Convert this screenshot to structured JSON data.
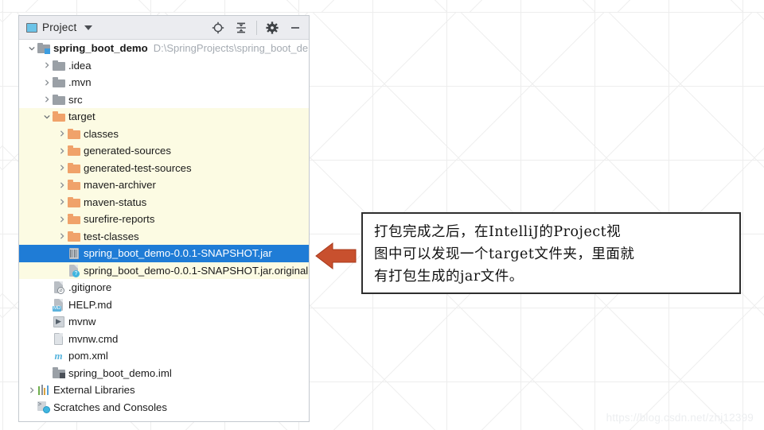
{
  "panel": {
    "header": {
      "icon": "project-view-icon",
      "title": "Project",
      "dropdown_icon": "chevron-down-icon",
      "tools": [
        {
          "name": "locate-in-tree-icon",
          "label": "Select Opened File"
        },
        {
          "name": "collapse-all-icon",
          "label": "Collapse All"
        },
        {
          "name": "gear-icon",
          "label": "Settings"
        },
        {
          "name": "minimize-icon",
          "label": "Hide"
        }
      ]
    },
    "tree": [
      {
        "indent": 0,
        "twisty": "expanded",
        "icon": "module-icon",
        "label": "spring_boot_demo",
        "bold": true,
        "path": "D:\\SpringProjects\\spring_boot_dem",
        "state": "normal"
      },
      {
        "indent": 1,
        "twisty": "collapsed",
        "icon": "folder-grey-icon",
        "label": ".idea",
        "state": "normal"
      },
      {
        "indent": 1,
        "twisty": "collapsed",
        "icon": "folder-grey-icon",
        "label": ".mvn",
        "state": "normal"
      },
      {
        "indent": 1,
        "twisty": "collapsed",
        "icon": "folder-grey-icon",
        "label": "src",
        "state": "normal"
      },
      {
        "indent": 1,
        "twisty": "expanded",
        "icon": "folder-orange-icon",
        "label": "target",
        "state": "highlight"
      },
      {
        "indent": 2,
        "twisty": "collapsed",
        "icon": "folder-orange-icon",
        "label": "classes",
        "state": "highlight"
      },
      {
        "indent": 2,
        "twisty": "collapsed",
        "icon": "folder-orange-icon",
        "label": "generated-sources",
        "state": "highlight"
      },
      {
        "indent": 2,
        "twisty": "collapsed",
        "icon": "folder-orange-icon",
        "label": "generated-test-sources",
        "state": "highlight"
      },
      {
        "indent": 2,
        "twisty": "collapsed",
        "icon": "folder-orange-icon",
        "label": "maven-archiver",
        "state": "highlight"
      },
      {
        "indent": 2,
        "twisty": "collapsed",
        "icon": "folder-orange-icon",
        "label": "maven-status",
        "state": "highlight"
      },
      {
        "indent": 2,
        "twisty": "collapsed",
        "icon": "folder-orange-icon",
        "label": "surefire-reports",
        "state": "highlight"
      },
      {
        "indent": 2,
        "twisty": "collapsed",
        "icon": "folder-orange-icon",
        "label": "test-classes",
        "state": "highlight"
      },
      {
        "indent": 2,
        "twisty": "none",
        "icon": "jar-file-icon",
        "label": "spring_boot_demo-0.0.1-SNAPSHOT.jar",
        "state": "selected"
      },
      {
        "indent": 2,
        "twisty": "none",
        "icon": "unknown-file-icon",
        "label": "spring_boot_demo-0.0.1-SNAPSHOT.jar.original",
        "state": "highlight"
      },
      {
        "indent": 1,
        "twisty": "none",
        "icon": "gitignore-file-icon",
        "label": ".gitignore",
        "state": "normal"
      },
      {
        "indent": 1,
        "twisty": "none",
        "icon": "markdown-file-icon",
        "label": "HELP.md",
        "state": "normal"
      },
      {
        "indent": 1,
        "twisty": "none",
        "icon": "shell-script-icon",
        "label": "mvnw",
        "state": "normal"
      },
      {
        "indent": 1,
        "twisty": "none",
        "icon": "cmd-script-icon",
        "label": "mvnw.cmd",
        "state": "normal"
      },
      {
        "indent": 1,
        "twisty": "none",
        "icon": "maven-pom-icon",
        "label": "pom.xml",
        "state": "normal"
      },
      {
        "indent": 1,
        "twisty": "none",
        "icon": "iml-module-file-icon",
        "label": "spring_boot_demo.iml",
        "state": "normal"
      },
      {
        "indent": 0,
        "twisty": "collapsed",
        "icon": "external-libraries-icon",
        "label": "External Libraries",
        "state": "normal"
      },
      {
        "indent": 0,
        "twisty": "none",
        "icon": "scratches-icon",
        "label": "Scratches and Consoles",
        "state": "normal"
      }
    ]
  },
  "annotation": {
    "arrow_icon": "left-arrow-icon",
    "arrow_color": "#c8502e",
    "note": "打包完成之后，在IntelliJ的Project视\n图中可以发现一个target文件夹，里面就\n有打包生成的jar文件。"
  },
  "watermark": "https://blog.csdn.net/zhj12399",
  "colors": {
    "selection_blue": "#1f7cd6",
    "highlight_yellow": "#fcfbe3",
    "folder_orange": "#f0a26a",
    "folder_grey": "#9aa0a6",
    "header_grey": "#ebecf0"
  }
}
